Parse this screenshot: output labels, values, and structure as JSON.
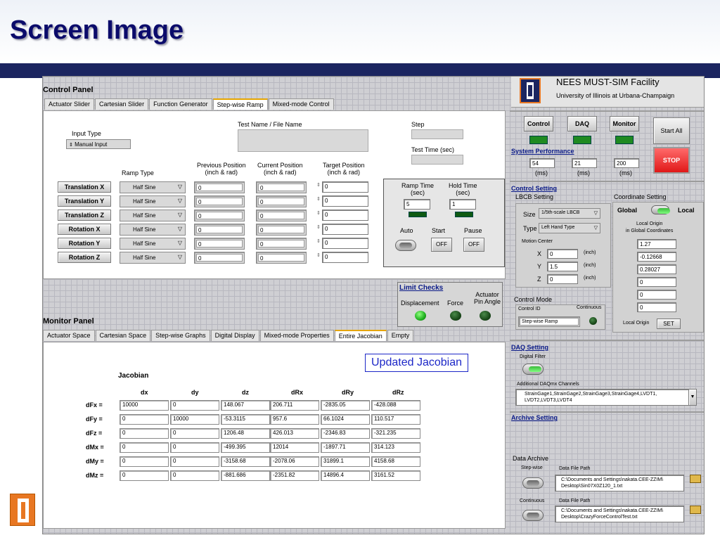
{
  "slide": {
    "title": "Screen Image"
  },
  "annotation": "Updated Jacobian",
  "control_panel": {
    "title": "Control Panel",
    "tabs": [
      "Actuator Slider",
      "Cartesian Slider",
      "Function Generator",
      "Step-wise Ramp",
      "Mixed-mode Control"
    ],
    "active_tab": "Step-wise Ramp",
    "input_type_label": "Input Type",
    "input_type_value": "Manual Input",
    "test_name_label": "Test Name / File Name",
    "test_name_value": "",
    "step_label": "Step",
    "step_value": "",
    "test_time_label": "Test Time (sec)",
    "test_time_value": "",
    "ramp_type_label": "Ramp Type",
    "prev_pos_label": "Previous Position\n(inch & rad)",
    "cur_pos_label": "Current Position\n(inch & rad)",
    "target_pos_label": "Target Position\n(inch & rad)",
    "axes": [
      {
        "label": "Translation X",
        "ramp": "Half Sine",
        "prev": "0",
        "cur": "0",
        "target": "0"
      },
      {
        "label": "Translation Y",
        "ramp": "Half Sine",
        "prev": "0",
        "cur": "0",
        "target": "0"
      },
      {
        "label": "Translation Z",
        "ramp": "Half Sine",
        "prev": "0",
        "cur": "0",
        "target": "0"
      },
      {
        "label": "Rotation X",
        "ramp": "Half Sine",
        "prev": "0",
        "cur": "0",
        "target": "0"
      },
      {
        "label": "Rotation Y",
        "ramp": "Half Sine",
        "prev": "0",
        "cur": "0",
        "target": "0"
      },
      {
        "label": "Rotation Z",
        "ramp": "Half Sine",
        "prev": "0",
        "cur": "0",
        "target": "0"
      }
    ],
    "ramp_time_label": "Ramp Time\n(sec)",
    "ramp_time_value": "5",
    "hold_time_label": "Hold Time\n(sec)",
    "hold_time_value": "1",
    "auto_label": "Auto",
    "start_label": "Start",
    "pause_label": "Pause",
    "start_btn": "OFF",
    "pause_btn": "OFF"
  },
  "limit_checks": {
    "title": "Limit Checks",
    "displacement": "Displacement",
    "force": "Force",
    "actuator_pin": "Actuator\nPin Angle"
  },
  "monitor_panel": {
    "title": "Monitor Panel",
    "tabs": [
      "Actuator Space",
      "Cartesian Space",
      "Step-wise Graphs",
      "Digital Display",
      "Mixed-mode Properties",
      "Entire Jacobian",
      "Empty"
    ],
    "active_tab": "Entire Jacobian",
    "jacobian_title": "Jacobian",
    "col_headers": [
      "dx",
      "dy",
      "dz",
      "dRx",
      "dRy",
      "dRz"
    ],
    "rows": [
      {
        "label": "dFx  =",
        "values": [
          "10000",
          "0",
          "148.067",
          "206.711",
          "-2835.05",
          "-428.088"
        ]
      },
      {
        "label": "dFy  =",
        "values": [
          "0",
          "10000",
          "-53.3115",
          "957.6",
          "66.1024",
          "110.517"
        ]
      },
      {
        "label": "dFz  =",
        "values": [
          "0",
          "0",
          "1206.48",
          "426.013",
          "-2346.83",
          "-321.235"
        ]
      },
      {
        "label": "dMx  =",
        "values": [
          "0",
          "0",
          "-499.395",
          "12014",
          "-1897.71",
          "314.123"
        ]
      },
      {
        "label": "dMy  =",
        "values": [
          "0",
          "0",
          "-3158.68",
          "-2078.06",
          "31899.1",
          "4158.68"
        ]
      },
      {
        "label": "dMz  =",
        "values": [
          "0",
          "0",
          "-881.686",
          "-2351.82",
          "14896.4",
          "3161.52"
        ]
      }
    ]
  },
  "facility": {
    "name": "NEES MUST-SIM Facility",
    "univ": "University of Illinois at Urbana-Champaign"
  },
  "system": {
    "control_btn": "Control",
    "daq_btn": "DAQ",
    "monitor_btn": "Monitor",
    "start_all": "Start All",
    "stop": "STOP",
    "perf_label": "System Performance",
    "perf_values": [
      "54",
      "21",
      "200"
    ],
    "perf_unit": "(ms)"
  },
  "control_setting": {
    "title": "Control Setting",
    "lbcb_label": "LBCB Setting",
    "coord_label": "Coordinate Setting",
    "size_label": "Size",
    "size_value": "1/5th-scale LBCB",
    "type_label": "Type",
    "type_value": "Left Hand Type",
    "motion_center": "Motion Center",
    "mc": [
      {
        "axis": "X",
        "value": "0",
        "unit": "(inch)"
      },
      {
        "axis": "Y",
        "value": "1.5",
        "unit": "(inch)"
      },
      {
        "axis": "Z",
        "value": "0",
        "unit": "(inch)"
      }
    ],
    "global": "Global",
    "local": "Local",
    "local_origin_caption": "Local Origin\nin Global Coordinates",
    "local_origin_values": [
      "1.27",
      "-0.12668",
      "0.28027",
      "0",
      "0",
      "0"
    ],
    "control_mode": "Control Mode",
    "control_id": "Control ID",
    "continuous": "Continuous",
    "control_id_value": "Step-wise Ramp",
    "local_origin_btn_label": "Local Origin",
    "set_btn": "SET"
  },
  "daq_setting": {
    "title": "DAQ Setting",
    "digital_filter": "Digital Filter",
    "additional": "Additional DAQmx Channels",
    "channels": "StrainGage1,StrainGage2,StrainGage3,StrainGage4,LVDT1,\nLVDT2,LVDT3,LVDT4"
  },
  "archive": {
    "title": "Archive Setting",
    "data_archive": "Data Archive",
    "stepwise": "Step-wise",
    "continuous": "Continuous",
    "file_label": "Data File Path",
    "file1": "C:\\Documents and Settings\\nakata.CEE-ZZIM\\\nDesktop\\Sin07X0Z120_1.txt",
    "file2": "C:\\Documents and Settings\\nakata.CEE-ZZIM\\\nDesktop\\CrazyForceControlTest.txt"
  },
  "colors": {
    "band": "#1b2560",
    "title": "#0b0b6b",
    "annotation": "#1c27c7",
    "tab_active": "#e5a500",
    "stop": "#e01818",
    "logo": "#e87722"
  }
}
